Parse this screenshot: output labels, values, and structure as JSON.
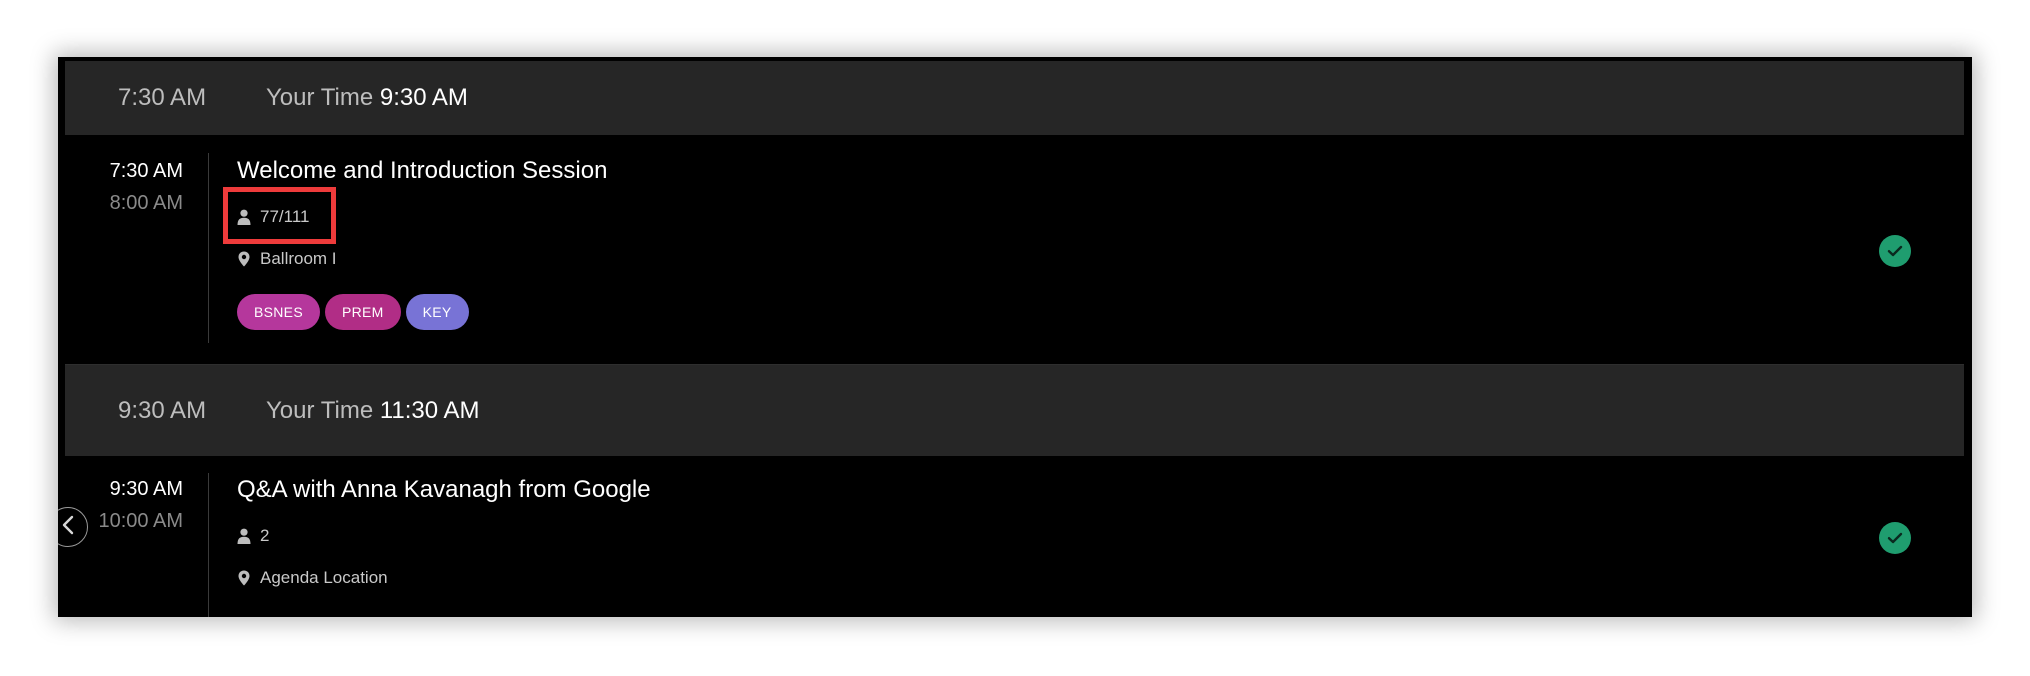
{
  "groups": [
    {
      "slot_time": "7:30 AM",
      "your_time_label": "Your Time",
      "your_time_value": "9:30 AM",
      "session": {
        "start": "7:30 AM",
        "end": "8:00 AM",
        "title": "Welcome and Introduction Session",
        "attendees": "77/111",
        "location": "Ballroom I",
        "tags": [
          {
            "label": "BSNES",
            "color": "#b5379c"
          },
          {
            "label": "PREM",
            "color": "#b12d86"
          },
          {
            "label": "KEY",
            "color": "#7873d6"
          }
        ],
        "status": "check-circle-icon"
      }
    },
    {
      "slot_time": "9:30 AM",
      "your_time_label": "Your Time",
      "your_time_value": "11:30 AM",
      "session": {
        "start": "9:30 AM",
        "end": "10:00 AM",
        "title": "Q&A with Anna Kavanagh from Google",
        "attendees": "2",
        "location": "Agenda Location",
        "tags": [],
        "status": "check-circle-icon"
      }
    }
  ],
  "colors": {
    "header_bg": "#262626",
    "check": "#1f9d6f",
    "highlight": "#ee3b3b"
  }
}
